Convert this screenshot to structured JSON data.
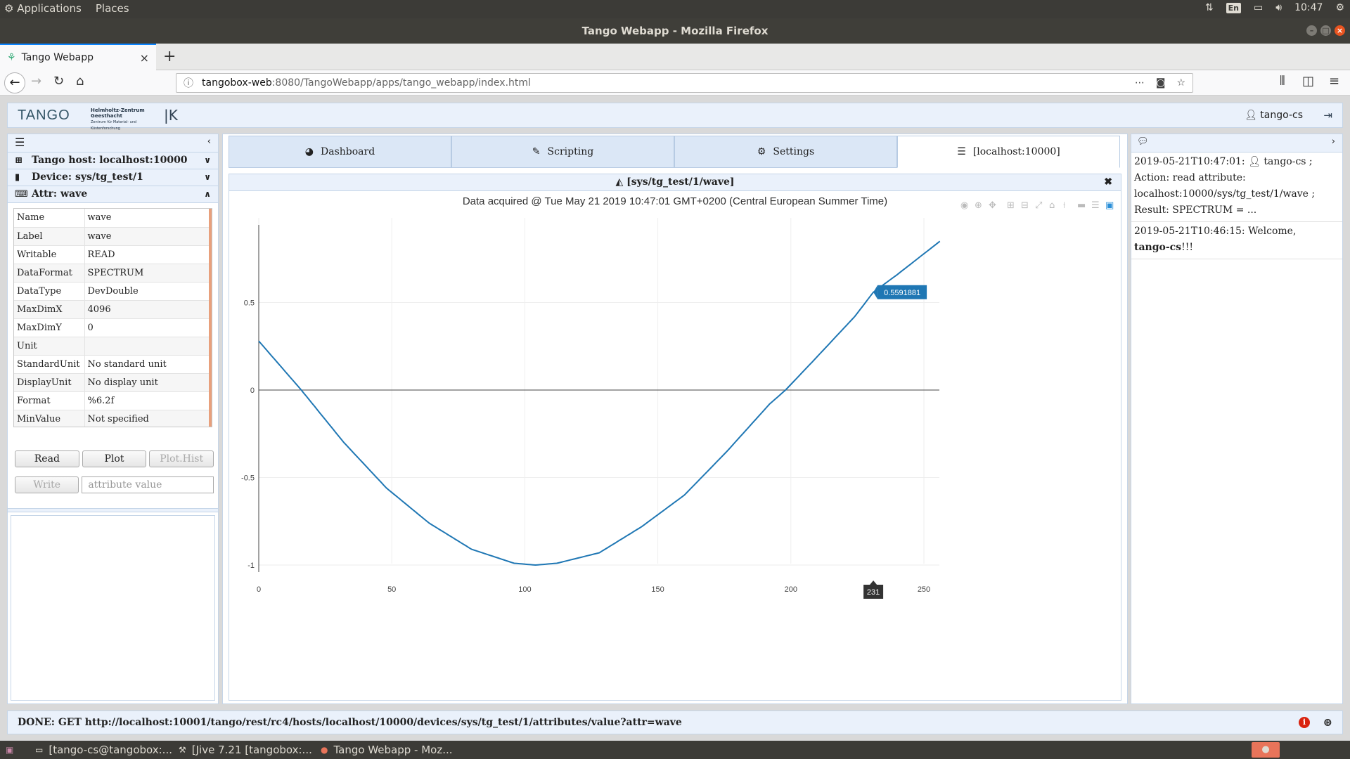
{
  "desktop": {
    "menu_applications": "Applications",
    "menu_places": "Places",
    "keyboard": "En",
    "clock": "10:47"
  },
  "window": {
    "title": "Tango Webapp - Mozilla Firefox"
  },
  "browser": {
    "tab_title": "Tango Webapp",
    "url_host": "tangobox-web",
    "url_path": ":8080/TangoWebapp/apps/tango_webapp/index.html"
  },
  "app": {
    "logo": "TANGO",
    "partner_logo": "Helmholtz-Zentrum Geesthacht",
    "partner_logo_sub": "Zentrum für Material- und Küstenforschung",
    "kit_logo": "|K",
    "user": "tango-cs"
  },
  "left": {
    "tango_host": "Tango host: localhost:10000",
    "device": "Device: sys/tg_test/1",
    "attr": "Attr: wave",
    "props": [
      {
        "key": "Name",
        "value": "wave"
      },
      {
        "key": "Label",
        "value": "wave"
      },
      {
        "key": "Writable",
        "value": "READ"
      },
      {
        "key": "DataFormat",
        "value": "SPECTRUM"
      },
      {
        "key": "DataType",
        "value": "DevDouble"
      },
      {
        "key": "MaxDimX",
        "value": "4096"
      },
      {
        "key": "MaxDimY",
        "value": "0"
      },
      {
        "key": "Unit",
        "value": ""
      },
      {
        "key": "StandardUnit",
        "value": "No standard unit"
      },
      {
        "key": "DisplayUnit",
        "value": "No display unit"
      },
      {
        "key": "Format",
        "value": "%6.2f"
      },
      {
        "key": "MinValue",
        "value": "Not specified"
      }
    ],
    "btn_read": "Read",
    "btn_plot": "Plot",
    "btn_plot_hist": "Plot.Hist",
    "btn_write": "Write",
    "input_placeholder": "attribute value"
  },
  "tabs": [
    {
      "label": "Dashboard",
      "icon": "dashboard-icon"
    },
    {
      "label": "Scripting",
      "icon": "edit-icon"
    },
    {
      "label": "Settings",
      "icon": "cogs-icon"
    },
    {
      "label": "[localhost:10000]",
      "icon": "database-icon"
    }
  ],
  "plot": {
    "panel_title": "[sys/tg_test/1/wave]",
    "title": "Data acquired @ Tue May 21 2019 10:47:01 GMT+0200 (Central European Summer Time)",
    "hover_label": "0.5591881",
    "hover_x": "231"
  },
  "chart_data": {
    "type": "line",
    "title": "Data acquired @ Tue May 21 2019 10:47:01 GMT+0200 (Central European Summer Time)",
    "xlabel": "",
    "ylabel": "",
    "xlim": [
      0,
      256
    ],
    "ylim": [
      -1,
      1
    ],
    "xticks": [
      0,
      50,
      100,
      150,
      200,
      250
    ],
    "yticks": [
      -1,
      -0.5,
      0,
      0.5
    ],
    "grid": true,
    "series_color": "#1f77b4",
    "series": [
      {
        "x": [
          0,
          16,
          32,
          48,
          64,
          80,
          96,
          104,
          112,
          128,
          144,
          160,
          176,
          192,
          198,
          208,
          224,
          231,
          240,
          256
        ],
        "values": [
          0.28,
          0.0,
          -0.3,
          -0.56,
          -0.76,
          -0.91,
          -0.99,
          -1.0,
          -0.99,
          -0.93,
          -0.78,
          -0.6,
          -0.35,
          -0.08,
          0.0,
          0.16,
          0.42,
          0.5591881,
          0.66,
          0.85
        ]
      }
    ],
    "hover_point": {
      "x": 231,
      "y": 0.5591881
    }
  },
  "right": {
    "log": [
      {
        "time": "2019-05-21T10:47:01:",
        "user": "tango-cs",
        "text": "Action: read attribute: localhost:10000/sys/tg_test/1/wave ; Result: SPECTRUM = ..."
      },
      {
        "time": "2019-05-21T10:46:15:",
        "text": "Welcome,",
        "user": "tango-cs",
        "suffix": "!!!"
      }
    ]
  },
  "status": {
    "text": "DONE: GET http://localhost:10001/tango/rest/rc4/hosts/localhost/10000/devices/sys/tg_test/1/attributes/value?attr=wave"
  },
  "taskbar": [
    {
      "label": "[tango-cs@tangobox:...",
      "icon": "terminal-icon"
    },
    {
      "label": "[Jive 7.21 [tangobox:...",
      "icon": "jive-icon"
    },
    {
      "label": "Tango Webapp - Moz...",
      "icon": "firefox-icon"
    }
  ]
}
